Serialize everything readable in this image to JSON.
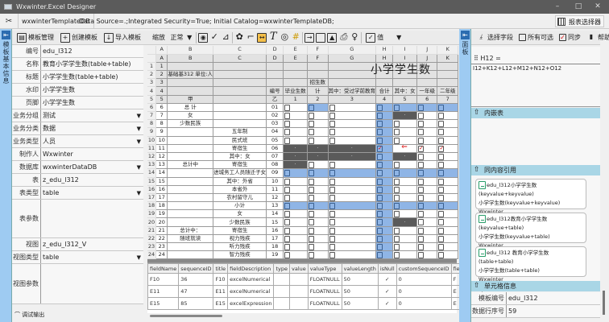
{
  "window": {
    "title": "Wxwinter.Excel Designer",
    "minimize": "–",
    "maximize": "□",
    "close": "✕"
  },
  "connection": {
    "database": "wxwinterTemplateDB",
    "connection_string": "Data Source=.;Integrated Security=True;  Initial Catalog=wxwinterTemplateDB;",
    "report_selector": "报表选择器"
  },
  "left_toolbar": {
    "template_manage": "模板管理",
    "create_template": "创建模板",
    "import_template": "导入模板",
    "save": "保存"
  },
  "left_panel": {
    "tab_label": "模板基本信息",
    "pin": "⇤",
    "fields": [
      {
        "label": "编号",
        "value": "edu_l312"
      },
      {
        "label": "名称",
        "value": "教育小学学生数(table+table)"
      },
      {
        "label": "标题",
        "value": "小学学生数(table+table)"
      },
      {
        "label": "水印",
        "value": "小学学生数"
      },
      {
        "label": "页脚",
        "value": "小学学生数"
      },
      {
        "label": "业务分组",
        "value": "测试",
        "dropdown": true
      },
      {
        "label": "业务分类",
        "value": "数据",
        "dropdown": true
      },
      {
        "label": "业务类型",
        "value": "人员",
        "dropdown": true
      },
      {
        "label": "制作人",
        "value": "Wxwinter"
      },
      {
        "label": "数据库",
        "value": "wxwinterDataDB",
        "dropdown": true
      },
      {
        "label": "表",
        "value": "z_edu_l312"
      },
      {
        "label": "表类型",
        "value": "table",
        "dropdown": true
      },
      {
        "label": "表参数",
        "value": ""
      },
      {
        "label": "视图",
        "value": "z_edu_l312_V"
      },
      {
        "label": "视图类型",
        "value": "table",
        "dropdown": true
      },
      {
        "label": "视图参数",
        "value": ""
      }
    ],
    "debug_output": "调试输出"
  },
  "sheet_toolbar": {
    "zoom_label": "缩放",
    "zoom_value": "正常",
    "value_label": "值"
  },
  "grid": {
    "columns": [
      "",
      "A",
      "B",
      "C",
      "D",
      "E",
      "F",
      "G",
      "H",
      "I",
      "J",
      "K"
    ],
    "title": "小学学生数",
    "rows": [
      {
        "n": "",
        "a": "A",
        "b": "B",
        "c": "C",
        "d": "D",
        "cells": [
          "E",
          "F",
          "G",
          "H",
          "I",
          "J",
          "K"
        ],
        "kind": "letters"
      },
      {
        "n": "1",
        "a": "1",
        "b": "",
        "c": "",
        "d": "",
        "cells": [
          "",
          "",
          "",
          "",
          "",
          "",
          ""
        ],
        "kind": "head"
      },
      {
        "n": "2",
        "a": "2",
        "b": "基础基312 单位:人",
        "c": "",
        "d": "",
        "cells": [
          "",
          "",
          "",
          "",
          "",
          "",
          ""
        ],
        "kind": "head"
      },
      {
        "n": "3",
        "a": "3",
        "b": "",
        "c": "",
        "d": "",
        "cells": [
          "",
          "招生数",
          "",
          "",
          "",
          "",
          ""
        ],
        "kind": "head"
      },
      {
        "n": "4",
        "a": "4",
        "b": "",
        "c": "",
        "d": "编号",
        "cells": [
          "毕业生数",
          "计",
          "其中：受过学前教育",
          "合计",
          "其中：女",
          "一年级",
          "二年级"
        ],
        "kind": "head"
      },
      {
        "n": "5",
        "a": "5",
        "b": "甲",
        "c": "",
        "d": "乙",
        "cells": [
          "1",
          "2",
          "3",
          "4",
          "5",
          "6",
          "7"
        ],
        "kind": "head"
      },
      {
        "n": "6",
        "a": "6",
        "b": "总 计",
        "c": "",
        "d": "01",
        "cells": [
          "cb",
          "bl",
          "cb",
          "bl",
          "bl",
          "bl",
          "bl"
        ]
      },
      {
        "n": "7",
        "a": "7",
        "b": "女",
        "c": "",
        "d": "02",
        "cells": [
          "cb",
          "cb",
          "cb",
          "bl",
          "dk",
          "cb",
          "cb"
        ]
      },
      {
        "n": "8",
        "a": "8",
        "b": "少数民族",
        "c": "",
        "d": "03",
        "cells": [
          "cb",
          "cb",
          "cb",
          "bl",
          "cb",
          "cb",
          "cb"
        ]
      },
      {
        "n": "9",
        "a": "9",
        "b": "",
        "c": "五年制",
        "d": "04",
        "cells": [
          "cb",
          "cb",
          "cb",
          "bl",
          "cb",
          "cb",
          "cb"
        ]
      },
      {
        "n": "10",
        "a": "10",
        "b": "",
        "c": "民式班",
        "d": "05",
        "cells": [
          "cb",
          "cb",
          "cb",
          "bl",
          "cb",
          "cb",
          "cb"
        ]
      },
      {
        "n": "11",
        "a": "11",
        "b": "",
        "c": "寄宿生",
        "d": "06",
        "cells": [
          "dk",
          "dk",
          "dk",
          "ck",
          "ar",
          "ck",
          "ck"
        ]
      },
      {
        "n": "12",
        "a": "12",
        "b": "",
        "c": "其中：女",
        "d": "07",
        "cells": [
          "dk",
          "dk",
          "dk",
          "bl",
          "dk",
          "cb",
          "cb"
        ]
      },
      {
        "n": "13",
        "a": "13",
        "b": "总计中",
        "c": "寄宿生",
        "d": "08",
        "cells": [
          "dk",
          "cb",
          "cb",
          "bl",
          "cb",
          "cb",
          "cb"
        ]
      },
      {
        "n": "14",
        "a": "14",
        "b": "",
        "c": "进城务工人员随迁子女",
        "d": "09",
        "cells": [
          "bl",
          "bl",
          "bl",
          "bl",
          "bl",
          "bl",
          "bl"
        ]
      },
      {
        "n": "15",
        "a": "15",
        "b": "",
        "c": "其中：外省",
        "d": "10",
        "cells": [
          "cb",
          "cb",
          "cb",
          "bl",
          "cb",
          "cb",
          "cb"
        ]
      },
      {
        "n": "16",
        "a": "16",
        "b": "",
        "c": "本省外",
        "d": "11",
        "cells": [
          "cb",
          "cb",
          "cb",
          "bl",
          "cb",
          "cb",
          "cb"
        ]
      },
      {
        "n": "17",
        "a": "17",
        "b": "",
        "c": "农村留守儿",
        "d": "12",
        "cells": [
          "cb",
          "cb",
          "cb",
          "bl",
          "cb",
          "cb",
          "cb"
        ]
      },
      {
        "n": "18",
        "a": "18",
        "b": "",
        "c": "小计",
        "d": "13",
        "cells": [
          "bl",
          "bl",
          "bl",
          "bl",
          "bl",
          "bl",
          "bl"
        ]
      },
      {
        "n": "19",
        "a": "19",
        "b": "",
        "c": "女",
        "d": "14",
        "cells": [
          "cb",
          "cb",
          "cb",
          "bl",
          "cb",
          "cb",
          "cb"
        ]
      },
      {
        "n": "20",
        "a": "20",
        "b": "",
        "c": "少数民族",
        "d": "15",
        "cells": [
          "cb",
          "cb",
          "cb",
          "bl",
          "dk",
          "cb",
          "cb"
        ]
      },
      {
        "n": "21",
        "a": "21",
        "b": "总计中：",
        "c": "寄宿生",
        "d": "16",
        "cells": [
          "cb",
          "cb",
          "cb",
          "bl",
          "cb",
          "cb",
          "cb"
        ]
      },
      {
        "n": "22",
        "a": "22",
        "b": "随班就读",
        "c": "视力残疾",
        "d": "17",
        "cells": [
          "cb",
          "cb",
          "cb",
          "bl",
          "cb",
          "cb",
          "cb"
        ]
      },
      {
        "n": "23",
        "a": "23",
        "b": "",
        "c": "听力残疾",
        "d": "18",
        "cells": [
          "cb",
          "cb",
          "cb",
          "bl",
          "cb",
          "cb",
          "cb"
        ]
      },
      {
        "n": "24",
        "a": "24",
        "b": "",
        "c": "智力残疾",
        "d": "19",
        "cells": [
          "cb",
          "cb",
          "cb",
          "bl",
          "cb",
          "cb",
          "cb"
        ]
      }
    ]
  },
  "fields_table": {
    "headers": [
      "fieldName",
      "sequenceID",
      "title",
      "fieldDescription",
      "type",
      "value",
      "valueType",
      "valueLength",
      "isNull",
      "customSequenceID",
      "fieldGroup"
    ],
    "rows": [
      [
        "F10",
        "36",
        "F10",
        "excelNumerical",
        "",
        "",
        "FLOATNULL",
        "50",
        "✓",
        "0",
        "F"
      ],
      [
        "E11",
        "47",
        "E11",
        "excelNumerical",
        "",
        "",
        "FLOATNULL",
        "50",
        "✓",
        "0",
        "E"
      ],
      [
        "E15",
        "85",
        "E15",
        "excelExpression",
        "",
        "",
        "FLOATNULL",
        "50",
        "✓",
        "0",
        "E"
      ]
    ]
  },
  "right_panel": {
    "tab_label": "面板",
    "select_field": "选择字段",
    "all_selectable": "所有可选",
    "sync": "同步",
    "help": "帮助",
    "formula_cell": "H12 =",
    "formula": "I12+K12+L12+M12+N12+O12",
    "embedded_table": "内嵌表",
    "same_content_ref": "同内容引用",
    "refs": [
      {
        "line1": "edu_l312小学学生数(keyvalue+keyvalue)",
        "line2": "小学学生数(keyvalue+keyvalue)",
        "line3": "Wxwinter"
      },
      {
        "line1": "edu_l312教育小学学生数(keyvalue+table)",
        "line2": "小学学生数(keyvalue+table)",
        "line3": "Wxwinter"
      },
      {
        "line1": "edu_l312    教育小学学生数(table+table)",
        "line2": "小学学生数(table+table)",
        "line3": "Wxwinter"
      }
    ],
    "cell_info": "单元格信息",
    "info": [
      {
        "label": "模板编号",
        "value": "edu_l312"
      },
      {
        "label": "数据行序号",
        "value": "59"
      }
    ]
  }
}
